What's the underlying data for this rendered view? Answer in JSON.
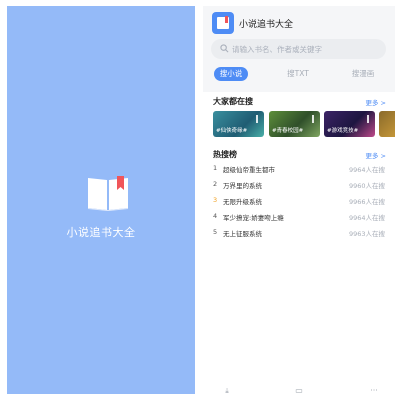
{
  "splash": {
    "title": "小说追书大全",
    "background": "#94baf8",
    "icon": "book-icon"
  },
  "home": {
    "app_name": "小说追书大全",
    "search": {
      "placeholder": "请输入书名、作者或关键字"
    },
    "tabs": [
      {
        "label": "搜小说",
        "active": true
      },
      {
        "label": "搜TXT",
        "active": false
      },
      {
        "label": "搜漫画",
        "active": false
      }
    ],
    "popular": {
      "title": "大家都在搜",
      "more": "更多",
      "banners": [
        {
          "tag": "#仙侠奇缘#"
        },
        {
          "tag": "#青春校园#"
        },
        {
          "tag": "#游戏竞技#"
        },
        {
          "tag": ""
        }
      ]
    },
    "hot": {
      "title": "热搜榜",
      "more": "更多",
      "items": [
        {
          "rank": "1",
          "name": "超级仙帝重生都市",
          "count": "9964人在搜"
        },
        {
          "rank": "2",
          "name": "万界里的系统",
          "count": "9960人在搜"
        },
        {
          "rank": "3",
          "name": "无限升级系统",
          "count": "9966人在搜"
        },
        {
          "rank": "4",
          "name": "军少撩宠:娇妻吻上瘾",
          "count": "9964人在搜"
        },
        {
          "rank": "5",
          "name": "无上征服系统",
          "count": "9963人在搜"
        }
      ]
    },
    "accent": "#4e8cf5",
    "bottom_icons": [
      "download-icon",
      "folder-icon",
      "more-icon"
    ]
  }
}
